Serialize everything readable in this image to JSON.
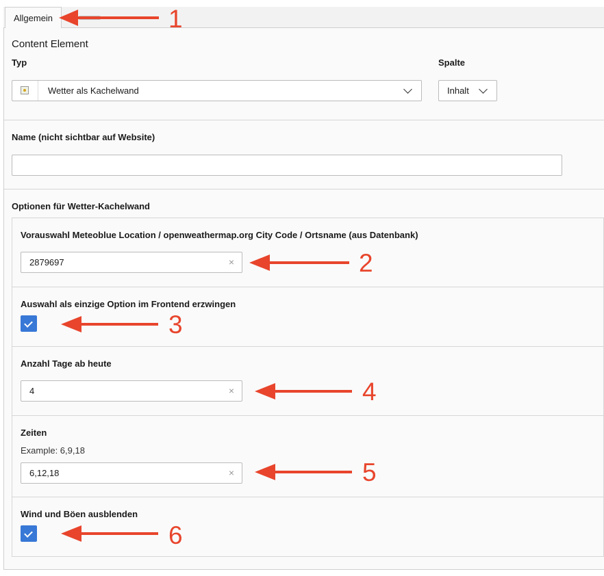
{
  "tabs": [
    {
      "label": "Allgemein"
    }
  ],
  "form": {
    "title": "Content Element",
    "typ": {
      "label": "Typ",
      "value": "Wetter als Kachelwand",
      "icon": "content-type-icon"
    },
    "spalte": {
      "label": "Spalte",
      "value": "Inhalt"
    },
    "name": {
      "label": "Name (nicht sichtbar auf Website)",
      "value": ""
    },
    "options": {
      "heading": "Optionen für Wetter-Kachelwand",
      "location": {
        "label": "Vorauswahl Meteoblue Location / openweathermap.org City Code / Ortsname (aus Datenbank)",
        "value": "2879697"
      },
      "force_only": {
        "label": "Auswahl als einzige Option im Frontend erzwingen",
        "checked": true
      },
      "days": {
        "label": "Anzahl Tage ab heute",
        "value": "4"
      },
      "times": {
        "label": "Zeiten",
        "hint": "Example: 6,9,18",
        "value": "6,12,18"
      },
      "hide_wind": {
        "label": "Wind und Böen ausblenden",
        "checked": true
      }
    }
  },
  "annotations": [
    "1",
    "2",
    "3",
    "4",
    "5",
    "6"
  ],
  "colors": {
    "annotation": "#e8452c",
    "checkbox": "#3878d6"
  },
  "clear_glyph": "×"
}
